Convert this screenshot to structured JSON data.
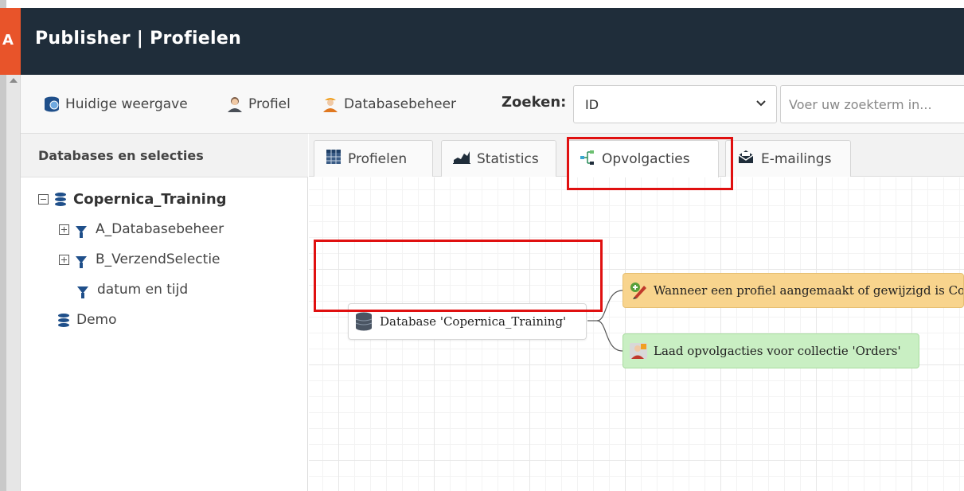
{
  "app": {
    "title": "Publisher | Profielen"
  },
  "toolbar": {
    "current_view_label": "Huidige weergave",
    "profile_label": "Profiel",
    "database_admin_label": "Databasebeheer",
    "search_label": "Zoeken:",
    "search_field_selected": "ID",
    "search_placeholder": "Voer uw zoekterm in..."
  },
  "sidebar": {
    "title": "Databases en selecties",
    "tree": [
      {
        "label": "Copernica_Training",
        "type": "database",
        "expanded": true
      },
      {
        "label": "A_Databasebeheer",
        "type": "selection",
        "expanded": false
      },
      {
        "label": "B_VerzendSelectie",
        "type": "selection",
        "expanded": false
      },
      {
        "label": "datum en tijd",
        "type": "selection"
      },
      {
        "label": "Demo",
        "type": "database"
      }
    ]
  },
  "tabs": [
    {
      "label": "Profielen",
      "icon": "grid-icon"
    },
    {
      "label": "Statistics",
      "icon": "area-chart-icon"
    },
    {
      "label": "Opvolgacties",
      "icon": "flow-icon",
      "active": true
    },
    {
      "label": "E-mailings",
      "icon": "envelope-icon"
    }
  ],
  "flow": {
    "database_node": "Database 'Copernica_Training'",
    "trigger_node": "Wanneer een profiel aangemaakt of gewijzigd is Cond",
    "load_node": "Laad opvolgacties voor collectie 'Orders'"
  },
  "colors": {
    "header_bg": "#1f2d3a",
    "accent": "#e8542a",
    "icon_blue": "#1f4f8a",
    "trigger_bg": "#f8d48d",
    "load_bg": "#c9efc3",
    "highlight": "#e01010"
  }
}
